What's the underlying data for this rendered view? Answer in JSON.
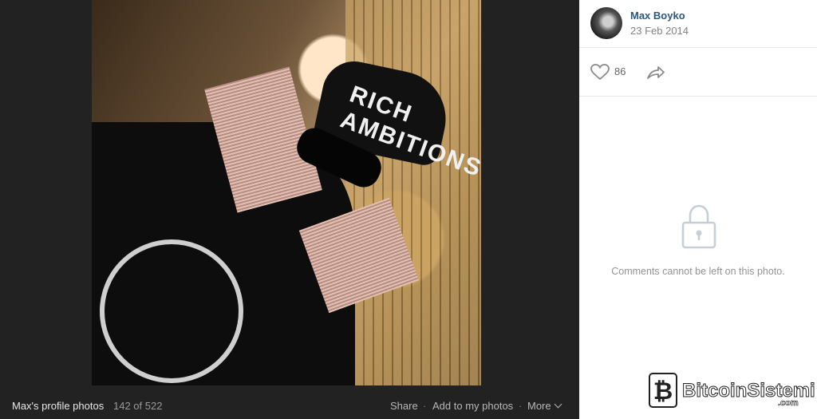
{
  "viewer": {
    "album_title": "Max's profile photos",
    "counter": "142 of 522",
    "actions": {
      "share": "Share",
      "add": "Add to my photos",
      "more": "More"
    },
    "photo_text": "RICH AMBITIONS"
  },
  "sidebar": {
    "author": "Max Boyko",
    "date": "23 Feb 2014",
    "likes": "86",
    "comments_notice": "Comments cannot be left on this photo."
  },
  "watermark": {
    "text": "BitcoinSistemi",
    "suffix": ".com"
  },
  "colors": {
    "viewer_bg": "#222222",
    "link": "#2a5885",
    "muted": "#828282"
  }
}
